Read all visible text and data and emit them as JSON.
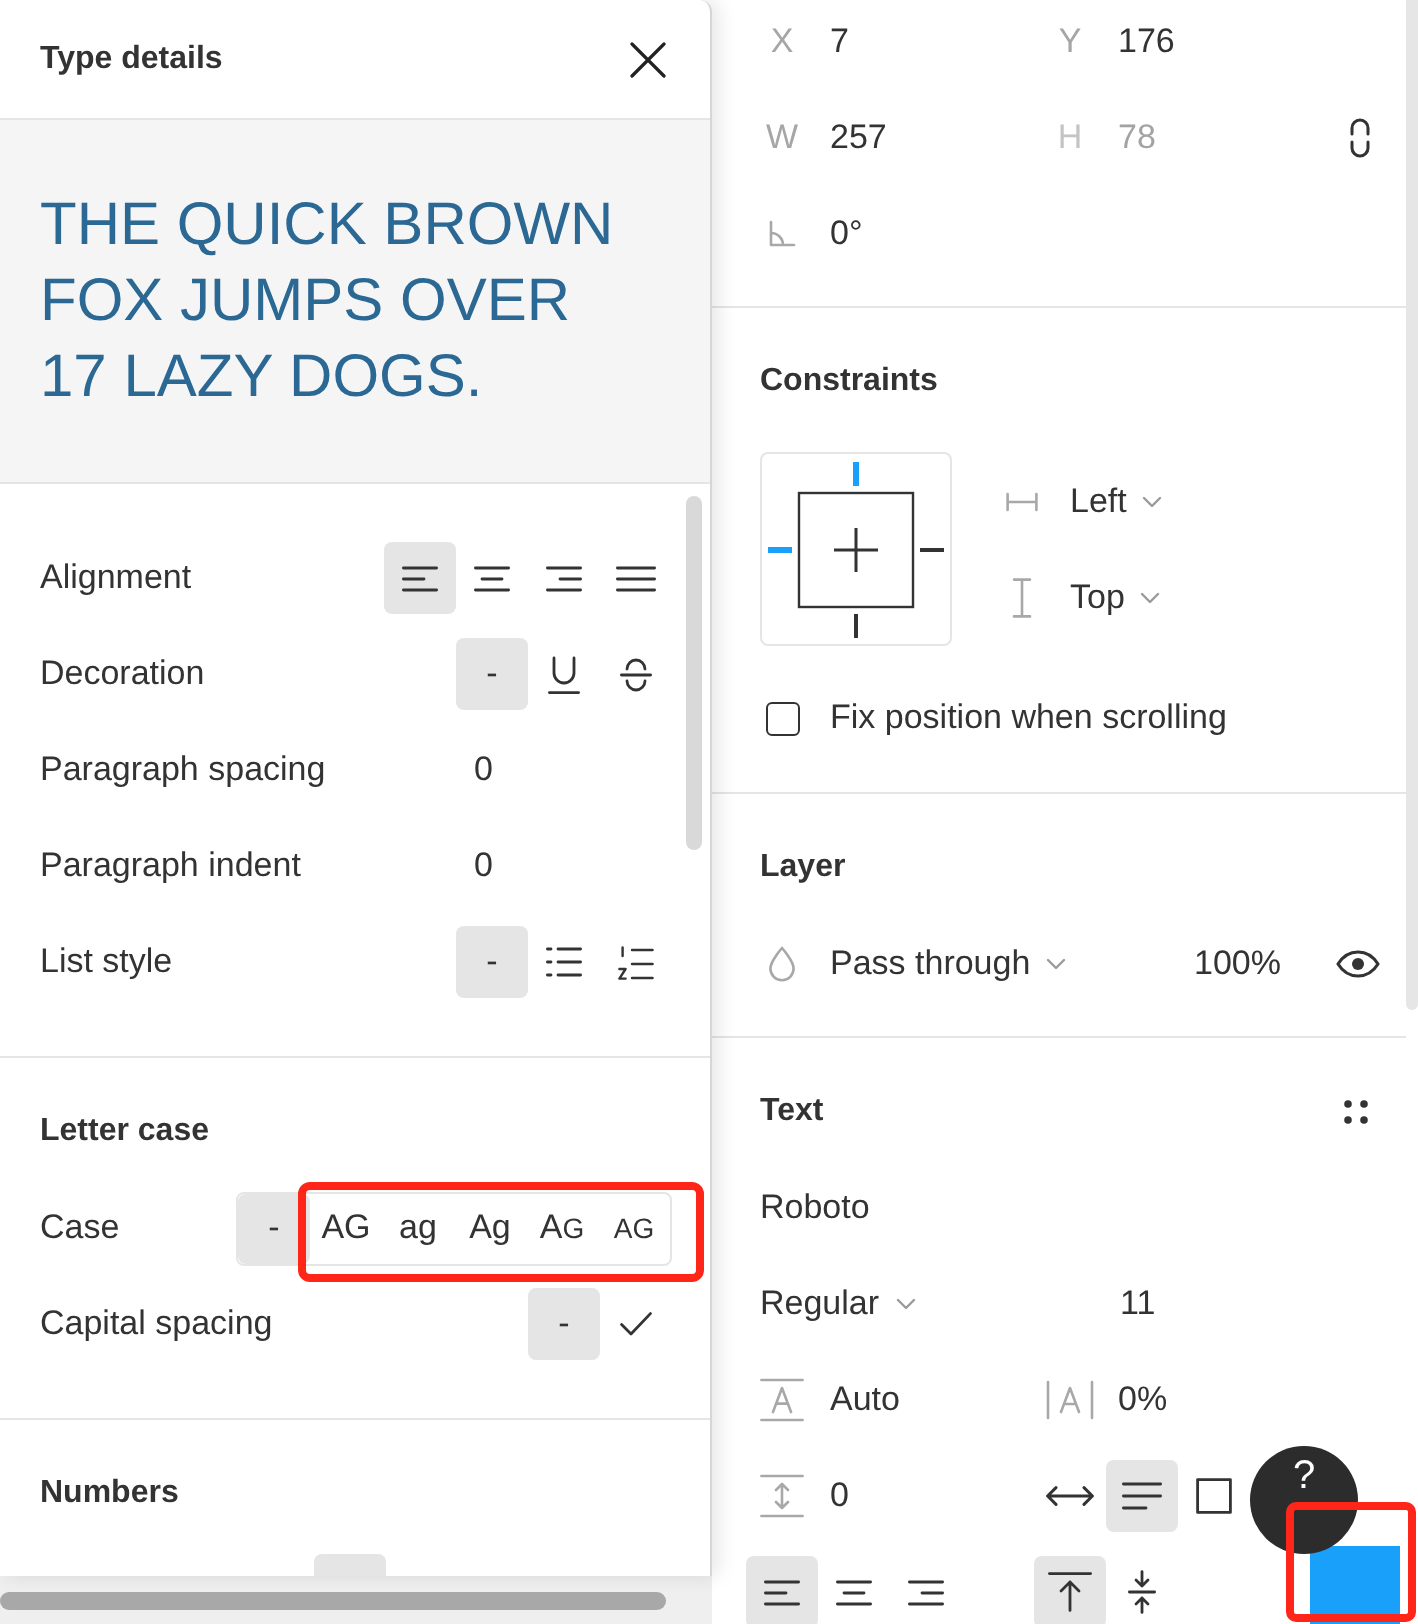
{
  "type_details": {
    "title": "Type details",
    "preview": "THE QUICK BROWN FOX JUMPS OVER 17 LAZY DOGS.",
    "sections": [
      {
        "rows": [
          {
            "kind": "options",
            "label": "Alignment",
            "options": [
              {
                "kind": "align_left",
                "selected": true
              },
              {
                "kind": "align_center",
                "selected": false
              },
              {
                "kind": "align_right",
                "selected": false
              },
              {
                "kind": "justify",
                "selected": false
              }
            ]
          },
          {
            "kind": "options",
            "label": "Decoration",
            "options": [
              {
                "kind": "text",
                "text": "-",
                "selected": true
              },
              {
                "kind": "underline",
                "selected": false
              },
              {
                "kind": "strikethrough",
                "selected": false
              }
            ]
          },
          {
            "kind": "value",
            "label": "Paragraph spacing",
            "value": "0"
          },
          {
            "kind": "value",
            "label": "Paragraph indent",
            "value": "0"
          },
          {
            "kind": "options",
            "label": "List style",
            "options": [
              {
                "kind": "text",
                "text": "-",
                "selected": true
              },
              {
                "kind": "bullet_list",
                "selected": false
              },
              {
                "kind": "numbered_list",
                "selected": false
              }
            ]
          }
        ]
      },
      {
        "title": "Letter case",
        "rows": [
          {
            "kind": "options",
            "label": "Case",
            "bordered": true,
            "highlighted": true,
            "options": [
              {
                "kind": "text",
                "text": "-",
                "selected": true
              },
              {
                "kind": "text",
                "text": "AG",
                "selected": false
              },
              {
                "kind": "text",
                "text": "ag",
                "selected": false
              },
              {
                "kind": "text",
                "text": "Ag",
                "selected": false
              },
              {
                "kind": "small_caps",
                "text": "AG",
                "selected": false
              },
              {
                "kind": "all_small_caps",
                "text": "AG",
                "selected": false
              }
            ]
          },
          {
            "kind": "options",
            "label": "Capital spacing",
            "options": [
              {
                "kind": "text",
                "text": "-",
                "selected": true
              },
              {
                "kind": "check",
                "selected": false
              }
            ]
          }
        ]
      },
      {
        "title": "Numbers",
        "rows": [
          {
            "kind": "partial",
            "options": [
              {
                "kind": "blank",
                "selected": true
              }
            ]
          }
        ]
      }
    ]
  },
  "transform": {
    "fields": [
      {
        "label": "X",
        "value": "7",
        "disabled": false
      },
      {
        "label": "Y",
        "value": "176",
        "disabled": false
      },
      {
        "label": "W",
        "value": "257",
        "disabled": false
      },
      {
        "label": "H",
        "value": "78",
        "disabled": true
      }
    ],
    "rotation": "0°"
  },
  "constraints": {
    "title": "Constraints",
    "pins": [
      {
        "kind": "top",
        "selected": true
      },
      {
        "kind": "left",
        "selected": true
      },
      {
        "kind": "right",
        "selected": false
      },
      {
        "kind": "bottom",
        "selected": false
      }
    ],
    "horizontal": "Left",
    "vertical": "Top",
    "fix_position": {
      "label": "Fix position when scrolling",
      "checked": false
    }
  },
  "layer": {
    "title": "Layer",
    "blend_mode": "Pass through",
    "opacity": "100%",
    "visible": true
  },
  "text": {
    "title": "Text",
    "font_family": "Roboto",
    "font_style": "Regular",
    "font_size": "11",
    "line_height": "Auto",
    "letter_spacing": "0%",
    "paragraph_spacing": "0",
    "resizing": [
      {
        "kind": "auto_width",
        "selected": false
      },
      {
        "kind": "auto_height",
        "selected": true
      },
      {
        "kind": "fixed",
        "selected": false
      }
    ],
    "align_horizontal": [
      {
        "kind": "align_left",
        "selected": true
      },
      {
        "kind": "align_center",
        "selected": false
      },
      {
        "kind": "align_right",
        "selected": false
      }
    ],
    "align_vertical": [
      {
        "kind": "top",
        "selected": true
      },
      {
        "kind": "middle",
        "selected": false
      }
    ]
  },
  "help_button": {
    "label": "?"
  },
  "action_button": {
    "highlighted": true
  }
}
